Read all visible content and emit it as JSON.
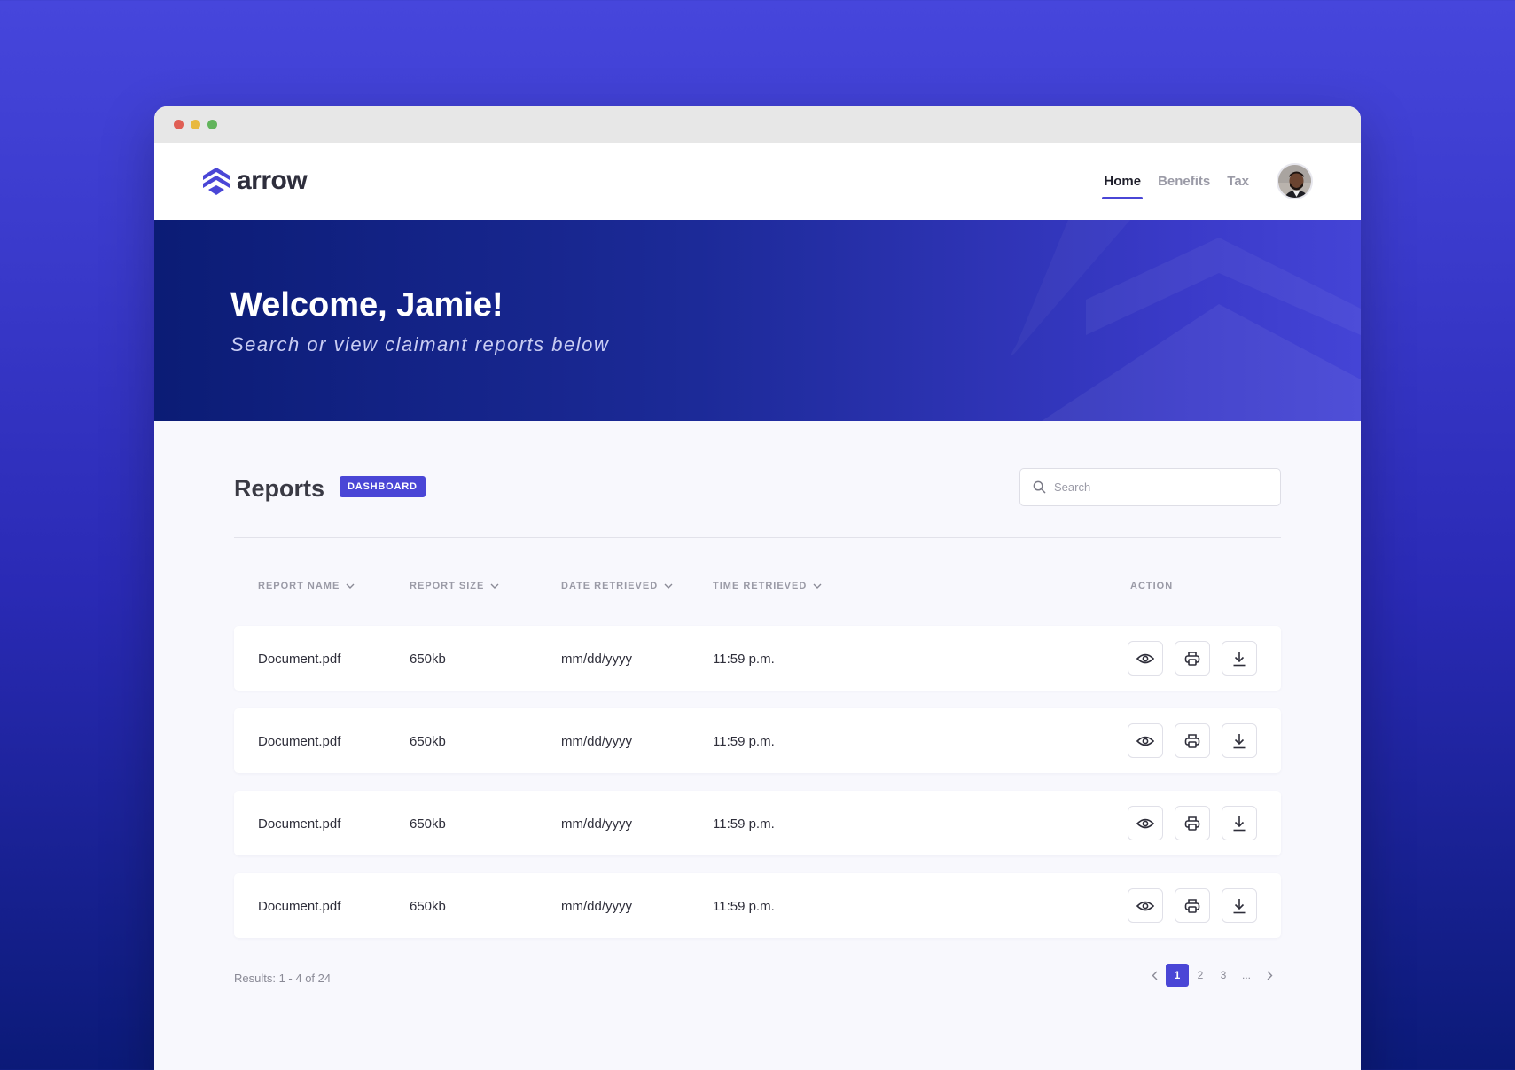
{
  "brand": {
    "name": "arrow",
    "accent": "#4a46d6"
  },
  "nav": {
    "items": [
      {
        "label": "Home",
        "active": true
      },
      {
        "label": "Benefits",
        "active": false
      },
      {
        "label": "Tax",
        "active": false
      }
    ]
  },
  "hero": {
    "title": "Welcome, Jamie!",
    "subtitle": "Search or view claimant reports below"
  },
  "reports": {
    "title": "Reports",
    "badge": "DASHBOARD",
    "search_placeholder": "Search",
    "columns": [
      "REPORT NAME",
      "REPORT SIZE",
      "DATE RETRIEVED",
      "TIME RETRIEVED",
      "ACTION"
    ],
    "rows": [
      {
        "name": "Document.pdf",
        "size": "650kb",
        "date": "mm/dd/yyyy",
        "time": "11:59 p.m."
      },
      {
        "name": "Document.pdf",
        "size": "650kb",
        "date": "mm/dd/yyyy",
        "time": "11:59 p.m."
      },
      {
        "name": "Document.pdf",
        "size": "650kb",
        "date": "mm/dd/yyyy",
        "time": "11:59 p.m."
      },
      {
        "name": "Document.pdf",
        "size": "650kb",
        "date": "mm/dd/yyyy",
        "time": "11:59 p.m."
      }
    ],
    "actions": [
      "eye-icon",
      "printer-icon",
      "download-icon"
    ]
  },
  "pagination": {
    "results_text": "Results: 1 - 4 of 24",
    "pages": [
      "1",
      "2",
      "3",
      "..."
    ],
    "current": "1"
  }
}
